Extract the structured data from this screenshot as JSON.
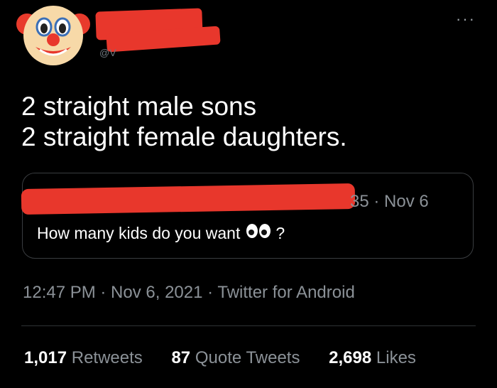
{
  "author": {
    "avatar_icon": "clown-face-icon",
    "handle_peek": "@V"
  },
  "tweet": {
    "lines": [
      "2 straight male sons",
      "2 straight female daughters."
    ]
  },
  "quoted_tweet": {
    "meta": "35 · Nov 6",
    "text": "How many kids do you want",
    "emoji_icon": "eyes-icon",
    "trailing": "?"
  },
  "timestamp": "12:47 PM · Nov 6, 2021 · Twitter for Android",
  "stats": [
    {
      "value": "1,017",
      "label": "Retweets"
    },
    {
      "value": "87",
      "label": "Quote Tweets"
    },
    {
      "value": "2,698",
      "label": "Likes"
    }
  ],
  "colors": {
    "background": "#000000",
    "redaction": "#e8372c",
    "secondary_text": "#8b9197"
  }
}
